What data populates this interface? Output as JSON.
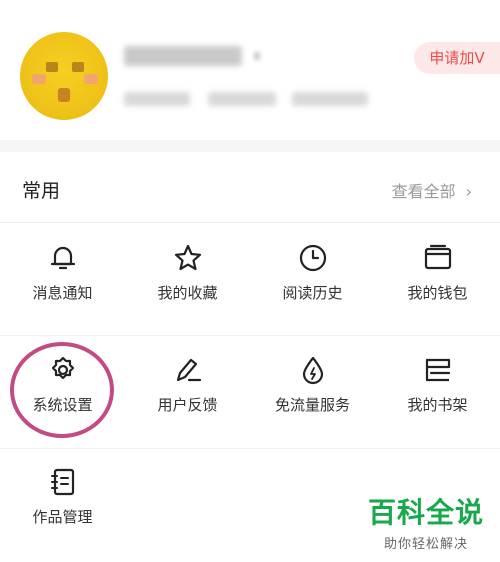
{
  "profile": {
    "apply_badge": "申请加V"
  },
  "common": {
    "title": "常用",
    "view_all": "查看全部",
    "items": [
      {
        "label": "消息通知",
        "icon": "bell-icon"
      },
      {
        "label": "我的收藏",
        "icon": "star-icon"
      },
      {
        "label": "阅读历史",
        "icon": "clock-icon"
      },
      {
        "label": "我的钱包",
        "icon": "wallet-icon"
      },
      {
        "label": "系统设置",
        "icon": "gear-icon"
      },
      {
        "label": "用户反馈",
        "icon": "pencil-icon"
      },
      {
        "label": "免流量服务",
        "icon": "drop-icon"
      },
      {
        "label": "我的书架",
        "icon": "bookshelf-icon"
      },
      {
        "label": "作品管理",
        "icon": "notebook-icon"
      }
    ]
  },
  "watermark": {
    "title": "百科全说",
    "subtitle": "助你轻松解决"
  },
  "colors": {
    "accent_red": "#ef4b4b",
    "highlight": "#c24b84",
    "watermark_green": "#1aa84d"
  }
}
